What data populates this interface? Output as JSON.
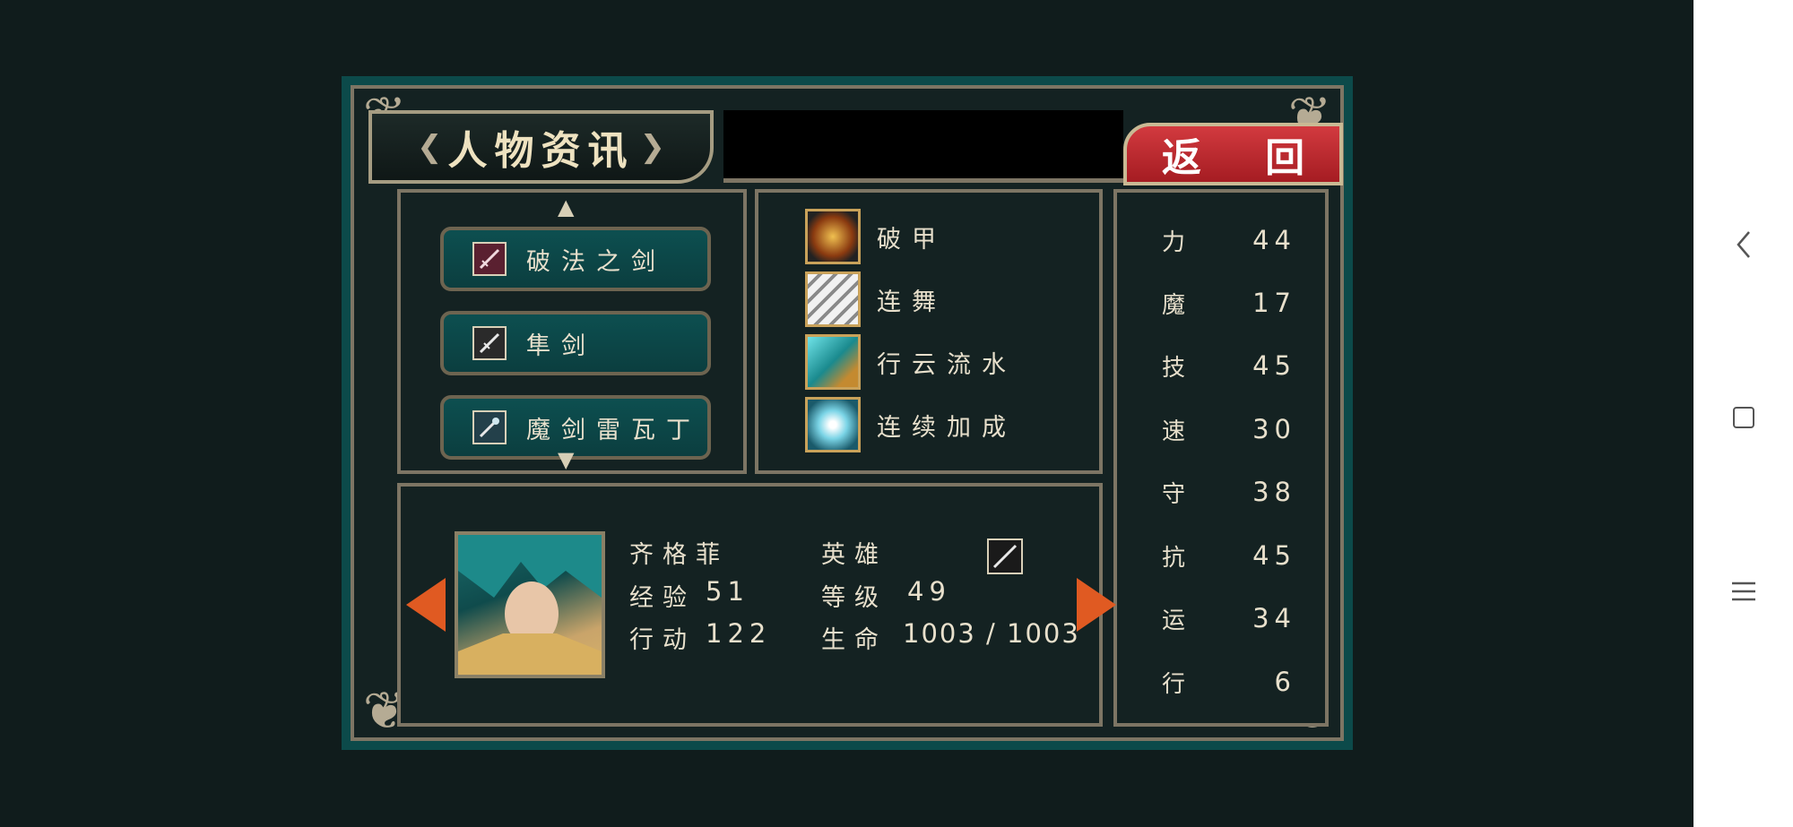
{
  "title": "人物资讯",
  "back_button": "返 回",
  "weapons": [
    {
      "label": "破法之剑",
      "icon": "red-sword-icon"
    },
    {
      "label": "隼剑",
      "icon": "sword-icon"
    },
    {
      "label": "魔剑雷瓦丁",
      "icon": "sword-icon"
    }
  ],
  "skills": [
    {
      "label": "破甲",
      "icon": "armor-break-icon"
    },
    {
      "label": "连舞",
      "icon": "slash-icon"
    },
    {
      "label": "行云流水",
      "icon": "flowing-sword-icon"
    },
    {
      "label": "连续加成",
      "icon": "burst-icon"
    }
  ],
  "stats": [
    {
      "label": "力",
      "value": "44"
    },
    {
      "label": "魔",
      "value": "17"
    },
    {
      "label": "技",
      "value": "45"
    },
    {
      "label": "速",
      "value": "30"
    },
    {
      "label": "守",
      "value": "38"
    },
    {
      "label": "抗",
      "value": "45"
    },
    {
      "label": "运",
      "value": "34"
    },
    {
      "label": "行",
      "value": "6"
    }
  ],
  "character": {
    "name": "齐格菲",
    "class": "英雄",
    "exp_label": "经验",
    "exp_value": "51",
    "level_label": "等级",
    "level_value": "49",
    "action_label": "行动",
    "action_value": "122",
    "hp_label": "生命",
    "hp_value": "1003 / 1003"
  },
  "colors": {
    "frame_teal": "#0c4a4a",
    "back_red": "#c5292f",
    "ornament": "#b5ab94",
    "arrow_orange": "#e05a22"
  }
}
